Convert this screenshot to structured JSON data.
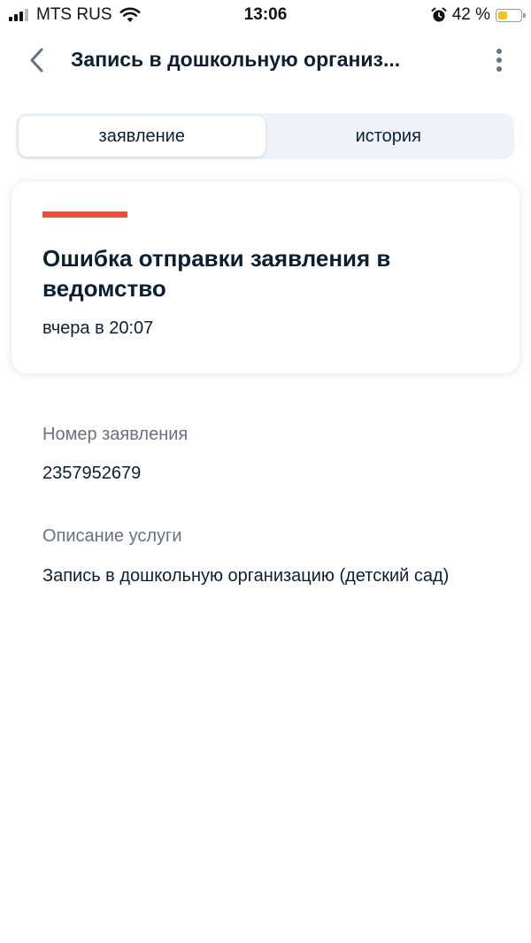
{
  "status_bar": {
    "carrier": "MTS RUS",
    "time": "13:06",
    "battery_percent": "42 %",
    "battery_level": 0.42,
    "icons": [
      "signal-icon",
      "wifi-icon",
      "alarm-icon",
      "battery-icon"
    ]
  },
  "header": {
    "title": "Запись в дошкольную организ...",
    "back_icon": "chevron-left-icon",
    "more_icon": "more-vertical-icon"
  },
  "tabs": [
    {
      "label": "заявление",
      "active": true
    },
    {
      "label": "история",
      "active": false
    }
  ],
  "status_card": {
    "stripe_color": "#e5533f",
    "title": "Ошибка отправки заявления в ведомство",
    "time": "вчера в 20:07"
  },
  "details": {
    "number_label": "Номер заявления",
    "number_value": "2357952679",
    "service_label": "Описание услуги",
    "service_value": "Запись в дошкольную организацию (детский сад)"
  },
  "colors": {
    "text_primary": "#0b1f33",
    "text_secondary": "#66727f",
    "tab_background": "#eef3f9",
    "error_accent": "#e5533f"
  }
}
